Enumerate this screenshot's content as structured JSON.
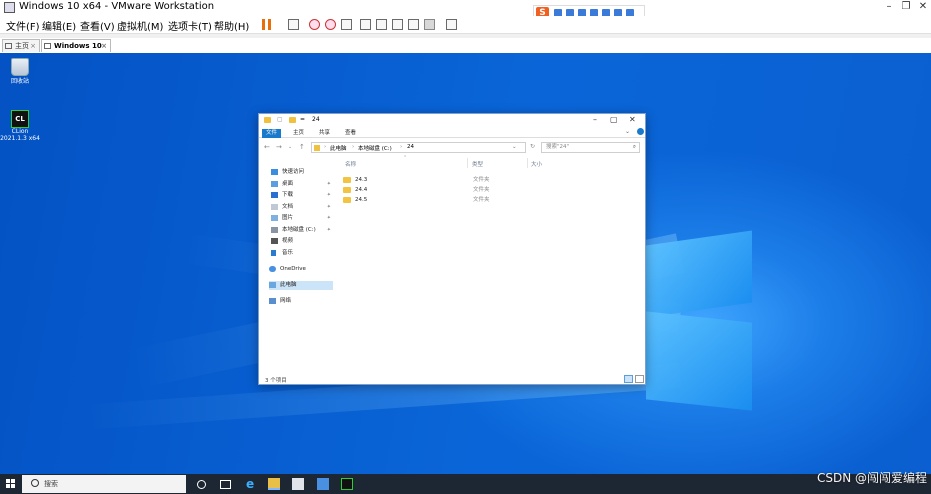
{
  "window": {
    "title": "Windows 10 x64 - VMware Workstation",
    "minimize": "–",
    "restore": "❐",
    "close": "✕"
  },
  "menu": {
    "items": [
      "文件(F)",
      "编辑(E)",
      "查看(V)",
      "虚拟机(M)",
      "选项卡(T)",
      "帮助(H)"
    ]
  },
  "ime": {
    "logo": "S"
  },
  "tabs": [
    {
      "label": "主页",
      "close": "×"
    },
    {
      "label": "Windows 10 x64",
      "close": "×"
    }
  ],
  "desktop": {
    "icons": [
      {
        "label": "回收站",
        "icon": "recycle-bin-icon"
      },
      {
        "label": "CLion",
        "sublabel": "2021.1.3 x64",
        "icon": "clion-icon",
        "badge": "CL"
      }
    ]
  },
  "explorer": {
    "title": "24",
    "title_prefix": "=",
    "ribbon_tabs": [
      "文件",
      "主页",
      "共享",
      "查看"
    ],
    "path": [
      "此电脑",
      "本地磁盘 (C:)",
      "24"
    ],
    "search_placeholder": "搜索\"24\"",
    "sidebar": [
      {
        "label": "快速访问",
        "icon": "star-icon",
        "pinned": false
      },
      {
        "label": "桌面",
        "icon": "desktop-icon",
        "pinned": true
      },
      {
        "label": "下载",
        "icon": "download-icon",
        "pinned": true
      },
      {
        "label": "文档",
        "icon": "document-icon",
        "pinned": true
      },
      {
        "label": "图片",
        "icon": "picture-icon",
        "pinned": true
      },
      {
        "label": "本地磁盘 (C:)",
        "icon": "drive-icon",
        "pinned": true
      },
      {
        "label": "视频",
        "icon": "video-icon",
        "pinned": false
      },
      {
        "label": "音乐",
        "icon": "music-icon",
        "pinned": false
      },
      {
        "label": "OneDrive",
        "icon": "cloud-icon",
        "pinned": false
      },
      {
        "label": "此电脑",
        "icon": "computer-icon",
        "pinned": false
      },
      {
        "label": "网络",
        "icon": "network-icon",
        "pinned": false
      }
    ],
    "columns": [
      "名称",
      "修改日期",
      "类型",
      "大小"
    ],
    "rows": [
      {
        "name": "24.3",
        "type": "文件夹"
      },
      {
        "name": "24.4",
        "type": "文件夹"
      },
      {
        "name": "24.5",
        "type": "文件夹"
      }
    ],
    "status": "3 个项目"
  },
  "taskbar": {
    "search_label": "搜索"
  },
  "watermark": "CSDN @闯闯爱编程"
}
